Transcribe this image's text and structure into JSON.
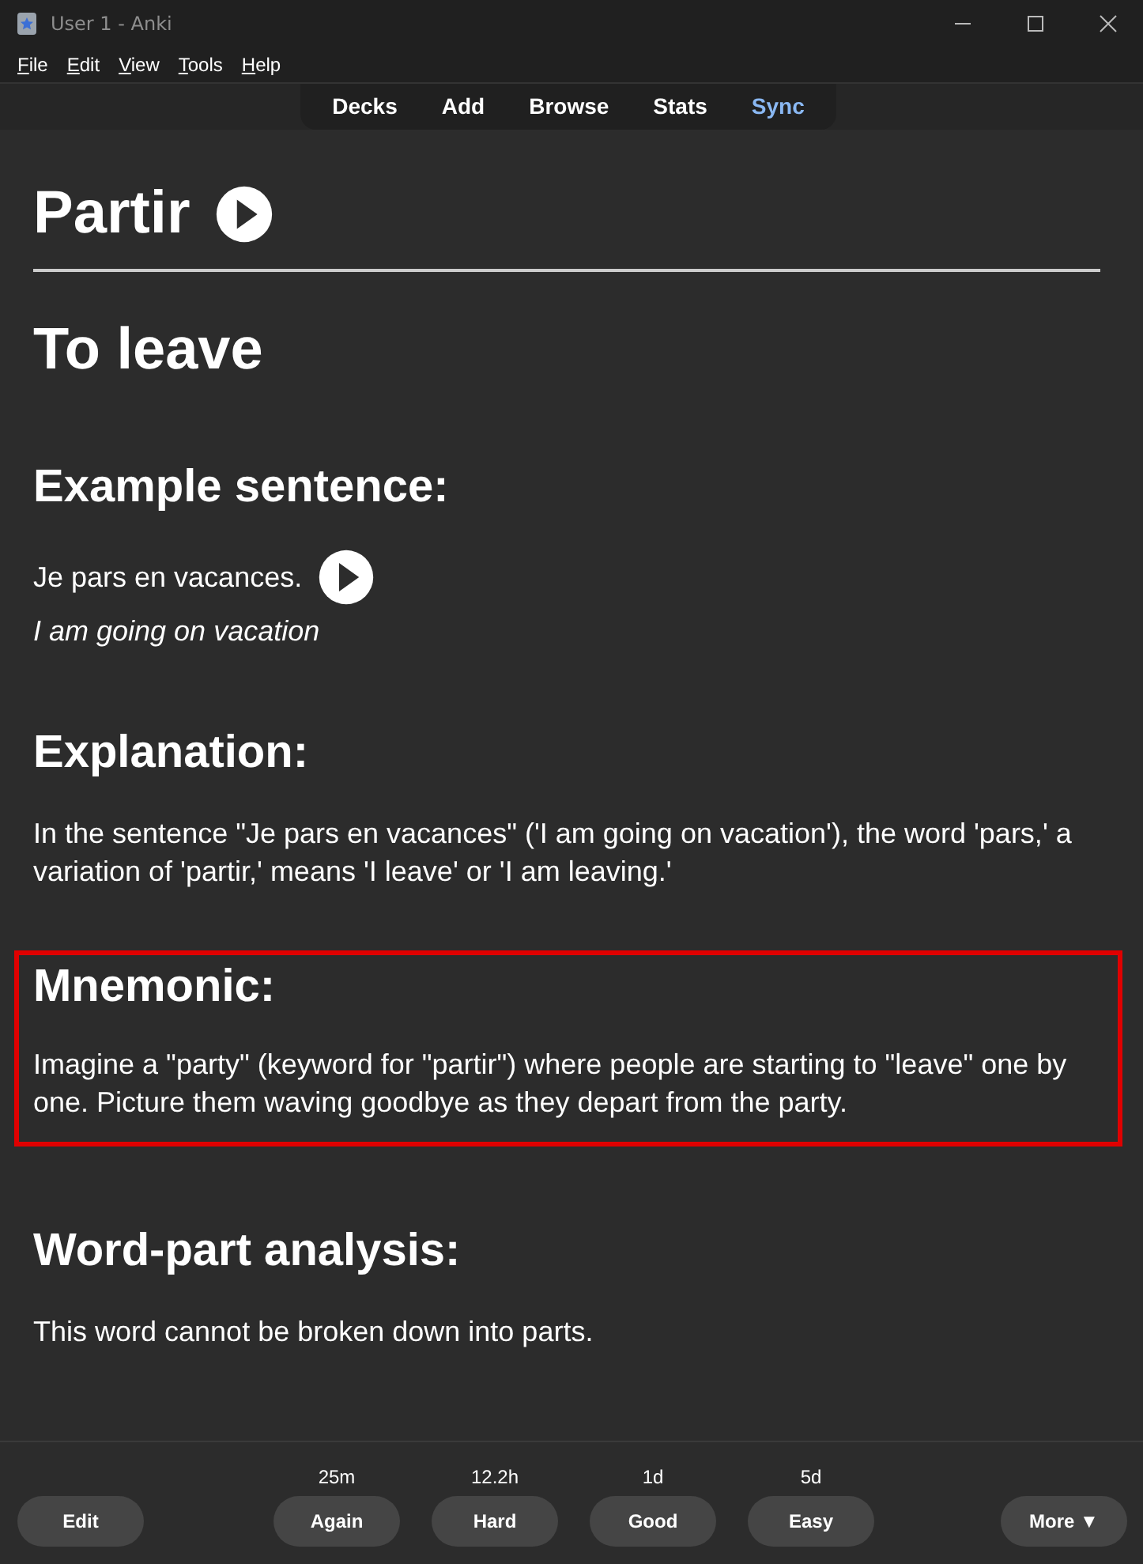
{
  "window": {
    "title": "User 1 - Anki"
  },
  "menu": [
    "File",
    "Edit",
    "View",
    "Tools",
    "Help"
  ],
  "toolbar": [
    {
      "label": "Decks",
      "highlighted": false
    },
    {
      "label": "Add",
      "highlighted": false
    },
    {
      "label": "Browse",
      "highlighted": false
    },
    {
      "label": "Stats",
      "highlighted": false
    },
    {
      "label": "Sync",
      "highlighted": true
    }
  ],
  "card": {
    "word": "Partir",
    "meaning": "To leave",
    "sections": [
      {
        "kind": "example",
        "heading": "Example sentence:",
        "sentence": "Je pars en vacances.",
        "translation": "I am going on vacation",
        "highlighted": false
      },
      {
        "kind": "text",
        "heading": "Explanation:",
        "text": "In the sentence \"Je pars en vacances\" ('I am going on vacation'), the word 'pars,' a variation of 'partir,' means 'I leave' or 'I am leaving.'",
        "highlighted": false
      },
      {
        "kind": "text",
        "heading": "Mnemonic:",
        "text": "Imagine a \"party\" (keyword for \"partir\") where people are starting to \"leave\" one by one. Picture them waving goodbye as they depart from the party.",
        "highlighted": true
      },
      {
        "kind": "text",
        "heading": "Word-part analysis:",
        "text": "This word cannot be broken down into parts.",
        "highlighted": false
      }
    ]
  },
  "bottom_bar": {
    "edit": "Edit",
    "answers": [
      {
        "interval": "25m",
        "label": "Again"
      },
      {
        "interval": "12.2h",
        "label": "Hard"
      },
      {
        "interval": "1d",
        "label": "Good"
      },
      {
        "interval": "5d",
        "label": "Easy"
      }
    ],
    "more": "More ▼"
  }
}
